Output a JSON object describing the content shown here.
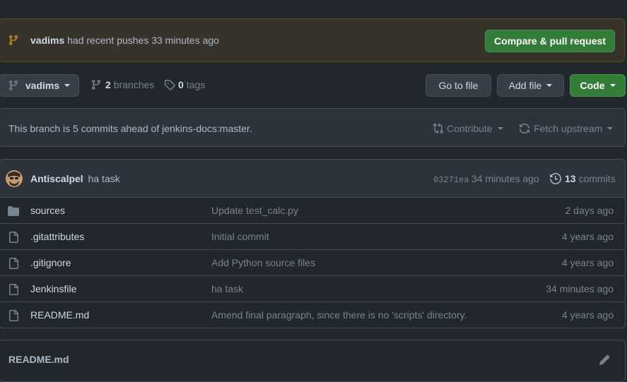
{
  "banner": {
    "user": "vadims",
    "message": "had recent pushes 33 minutes ago",
    "button": "Compare & pull request"
  },
  "toolbar": {
    "branch": "vadims",
    "branches_count": "2",
    "branches_label": "branches",
    "tags_count": "0",
    "tags_label": "tags",
    "go_to_file": "Go to file",
    "add_file": "Add file",
    "code": "Code"
  },
  "ahead": {
    "text": "This branch is 5 commits ahead of jenkins-docs:master.",
    "contribute": "Contribute",
    "fetch": "Fetch upstream"
  },
  "latest_commit": {
    "author": "Antiscalpel",
    "message": "ha task",
    "sha": "03271ea",
    "time": "34 minutes ago",
    "commits_count": "13",
    "commits_label": "commits"
  },
  "files": [
    {
      "icon": "folder-icon",
      "name": "sources",
      "message": "Update test_calc.py",
      "date": "2 days ago"
    },
    {
      "icon": "file-icon",
      "name": ".gitattributes",
      "message": "Initial commit",
      "date": "4 years ago"
    },
    {
      "icon": "file-icon",
      "name": ".gitignore",
      "message": "Add Python source files",
      "date": "4 years ago"
    },
    {
      "icon": "file-icon",
      "name": "Jenkinsfile",
      "message": "ha task",
      "date": "34 minutes ago"
    },
    {
      "icon": "file-icon",
      "name": "README.md",
      "message": "Amend final paragraph, since there is no 'scripts' directory.",
      "date": "4 years ago"
    }
  ],
  "readme": {
    "title": "README.md"
  },
  "colors": {
    "background": "#22272e",
    "banner_bg": "#37332a",
    "accent_green": "#347d39",
    "branch_icon": "#c69026"
  }
}
